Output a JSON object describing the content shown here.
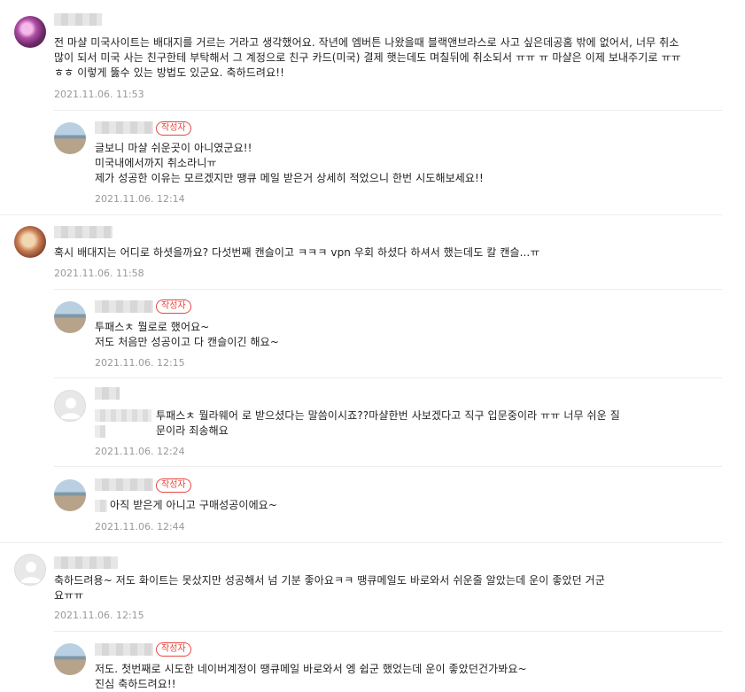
{
  "comments": [
    {
      "text": "전 마샬 미국사이트는 배대지를 거르는 거라고 생각했어요. 작년에 엠버튼 나왔을때 블랙앤브라스로 사고 싶은데공홈 밖에 없어서, 너무 취소 많이 되서 미국 사는 친구한테 부탁해서 그 계정으로 친구 카드(미국) 결제 햇는데도 며칠뒤에 취소되서 ㅠㅠ ㅠ 마샬은 이제 보내주기로 ㅠㅠ ㅎㅎ 이렇게 뚫수 있는 방법도 있군요. 축하드려요!!",
      "date": "2021.11.06. 11:53"
    },
    {
      "badge": "작성자",
      "text": "글보니 마샬 쉬운곳이 아니였군요!!\n미국내에서까지 취소라니ㅠ\n제가 성공한 이유는 모르겠지만 땡큐 메일 받은거 상세히 적었으니 한번 시도해보세요!!",
      "date": "2021.11.06. 12:14"
    },
    {
      "text": "혹시 배대지는 어디로 하셧을까요? 다섯번째 캔슬이고 ㅋㅋㅋ vpn 우회 하셨다 하셔서 했는데도 칼 캔슬...ㅠ",
      "date": "2021.11.06. 11:58"
    },
    {
      "badge": "작성자",
      "text": "투패스ㅊ 뭘로로 했어요~\n저도 처음만 성공이고 다 캔슬이긴 해요~",
      "date": "2021.11.06. 12:15"
    },
    {
      "text": "투패스ㅊ 뭘라웨어 로 받으셨다는 말씀이시죠??마샬한번 사보겠다고 직구 입문중이라 ㅠㅠ 너무 쉬운 질\n문이라 죄송해요",
      "date": "2021.11.06. 12:24"
    },
    {
      "badge": "작성자",
      "text": "아직 받은게 아니고 구매성공이에요~",
      "date": "2021.11.06. 12:44"
    },
    {
      "text": "축하드려용~ 저도 화이트는 못샀지만 성공해서 넘 기분 좋아요ㅋㅋ 땡큐메일도 바로와서 쉬운줄 알았는데 운이 좋았던 거군\n요ㅠㅠ",
      "date": "2021.11.06. 12:15"
    },
    {
      "badge": "작성자",
      "text": "저도. 첫번째로 시도한 네이버계정이 땡큐메일 바로와서 엥 쉽군 했었는데 운이 좋았던건가봐요~\n진심 축하드려요!!",
      "date": ""
    }
  ],
  "icons": {
    "avatar_default": "person-silhouette-icon"
  }
}
